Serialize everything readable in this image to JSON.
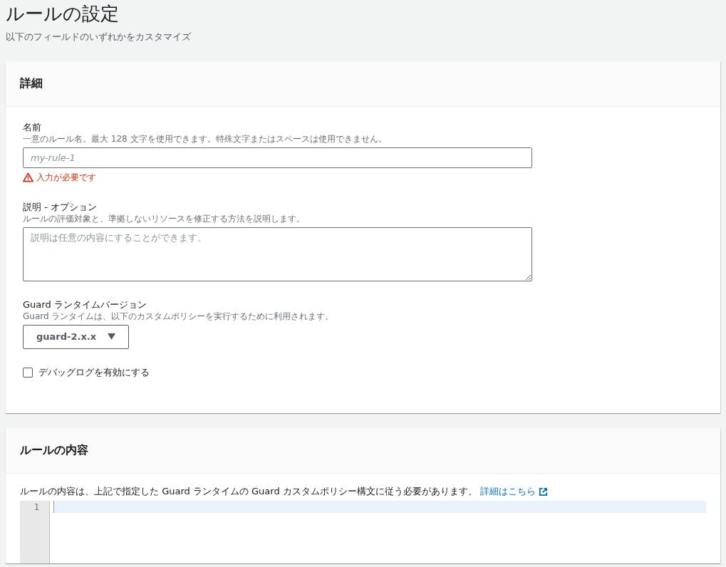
{
  "page": {
    "title": "ルールの設定",
    "subtitle": "以下のフィールドのいずれかをカスタマイズ"
  },
  "details": {
    "heading": "詳細",
    "name_field": {
      "label": "名前",
      "description": "一意のルール名。最大 128 文字を使用できます。特殊文字またはスペースは使用できません。",
      "placeholder": "my-rule-1",
      "error": "入力が必要です"
    },
    "description_field": {
      "label": "説明 - オプション",
      "description": "ルールの評価対象と、準拠しないリソースを修正する方法を説明します。",
      "placeholder": "説明は任意の内容にすることができます。"
    },
    "runtime_field": {
      "label": "Guard ランタイムバージョン",
      "description": "Guard ランタイムは、以下のカスタムポリシーを実行するために利用されます。",
      "value": "guard-2.x.x"
    },
    "debug_checkbox": {
      "label": "デバッグログを有効にする",
      "checked": false
    }
  },
  "content": {
    "heading": "ルールの内容",
    "note": "ルールの内容は、上記で指定した Guard ランタイムの Guard カスタムポリシー構文に従う必要があります。",
    "link": "詳細はこちら",
    "editor": {
      "line_numbers": [
        "1"
      ]
    }
  }
}
